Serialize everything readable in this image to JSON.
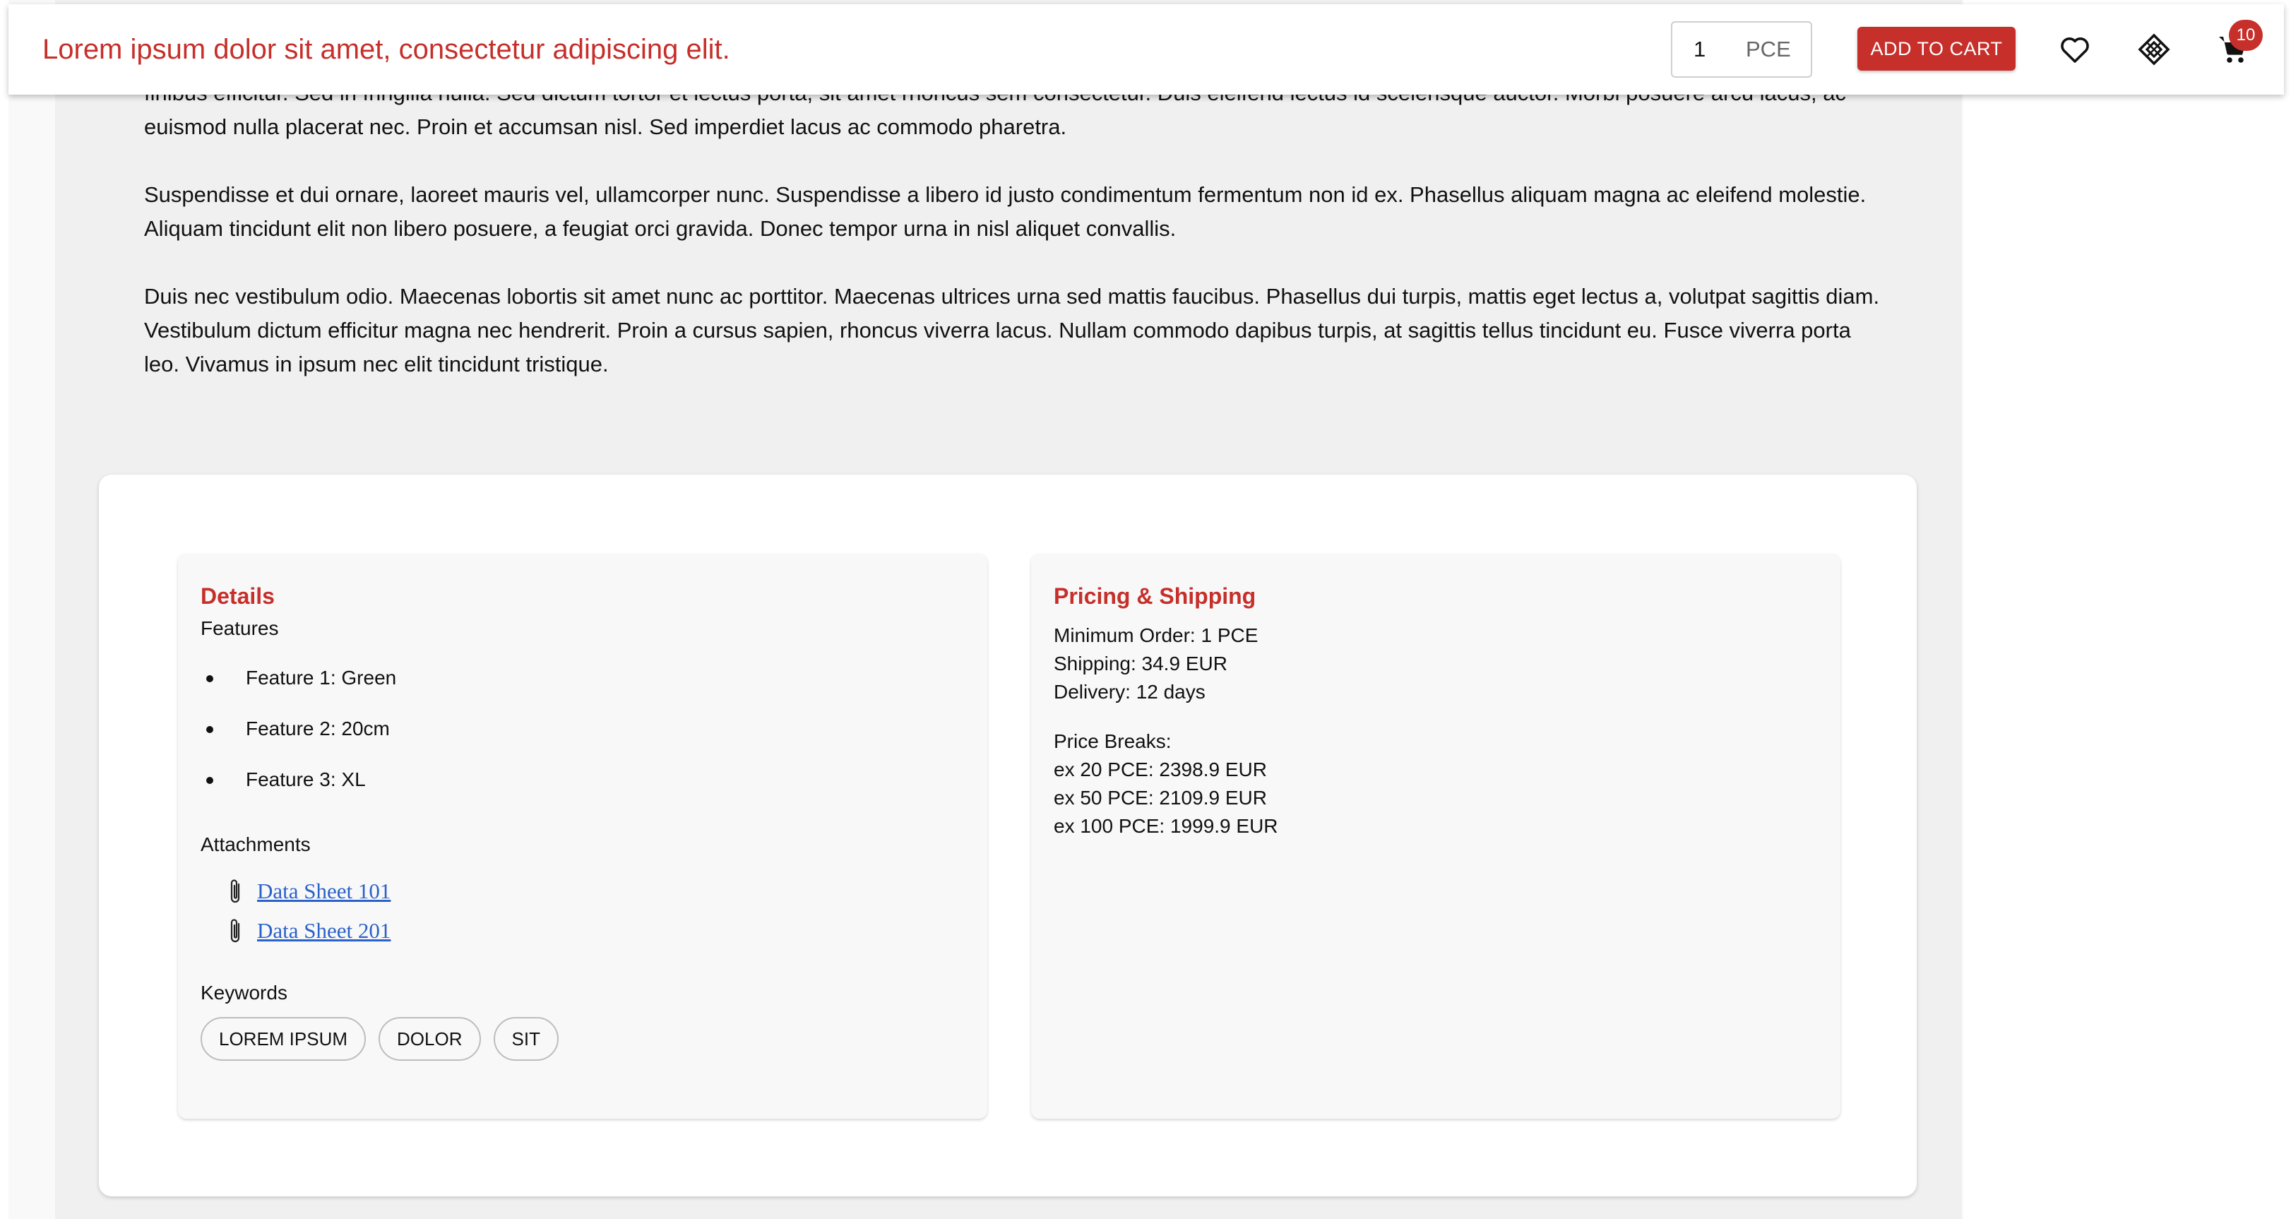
{
  "header": {
    "product_title": "Lorem ipsum dolor sit amet, consectetur adipiscing elit.",
    "quantity_value": "1",
    "quantity_unit": "PCE",
    "add_to_cart_label": "ADD TO CART",
    "cart_count": "10",
    "icons": [
      "heart-icon",
      "compare-icon",
      "cart-icon"
    ]
  },
  "description": {
    "paragraphs": [
      "finibus efficitur. Sed in fringilla nulla. Sed dictum tortor et lectus porta, sit amet rhoncus sem consectetur. Duis eleifend lectus id scelerisque auctor. Morbi posuere arcu lacus, ac euismod nulla placerat nec. Proin et accumsan nisl. Sed imperdiet lacus ac commodo pharetra.",
      "Suspendisse et dui ornare, laoreet mauris vel, ullamcorper nunc. Suspendisse a libero id justo condimentum fermentum non id ex. Phasellus aliquam magna ac eleifend molestie. Aliquam tincidunt elit non libero posuere, a feugiat orci gravida. Donec tempor urna in nisl aliquet convallis.",
      "Duis nec vestibulum odio. Maecenas lobortis sit amet nunc ac porttitor. Maecenas ultrices urna sed mattis faucibus. Phasellus dui turpis, mattis eget lectus a, volutpat sagittis diam. Vestibulum dictum efficitur magna nec hendrerit. Proin a cursus sapien, rhoncus viverra lacus. Nullam commodo dapibus turpis, at sagittis tellus tincidunt eu. Fusce viverra porta leo. Vivamus in ipsum nec elit tincidunt tristique."
    ]
  },
  "details": {
    "title": "Details",
    "features_heading": "Features",
    "features": [
      "Feature 1: Green",
      "Feature 2: 20cm",
      "Feature 3: XL"
    ],
    "attachments_heading": "Attachments",
    "attachments": [
      "Data Sheet 101",
      "Data Sheet 201"
    ],
    "keywords_heading": "Keywords",
    "keywords": [
      "LOREM IPSUM",
      "DOLOR",
      "SIT"
    ]
  },
  "pricing": {
    "title": "Pricing & Shipping",
    "minimum_order": "Minimum Order: 1 PCE",
    "shipping": "Shipping: 34.9 EUR",
    "delivery": "Delivery: 12 days",
    "price_breaks_heading": "Price Breaks:",
    "price_breaks": [
      "ex 20 PCE: 2398.9 EUR",
      "ex 50 PCE: 2109.9 EUR",
      "ex 100 PCE: 1999.9 EUR"
    ]
  },
  "colors": {
    "accent": "#c62f2a",
    "link": "#2a62c9",
    "page_background": "#f0f0f0"
  }
}
